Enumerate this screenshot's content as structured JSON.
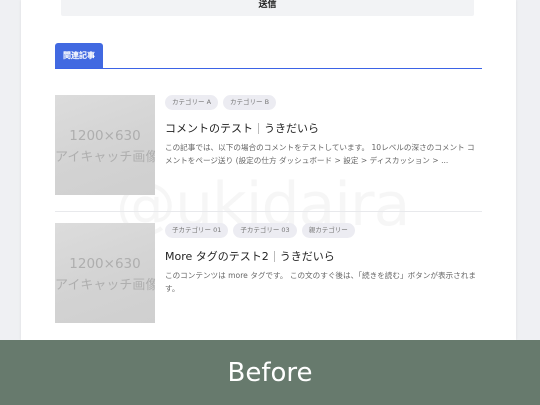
{
  "form": {
    "submit_label": "送信"
  },
  "related": {
    "heading": "関連記事",
    "articles": [
      {
        "thumbnail_line1": "1200×630",
        "thumbnail_line2": "アイキャッチ画像",
        "tags": [
          "カテゴリー A",
          "カテゴリー B"
        ],
        "title": "コメントのテスト",
        "author": "うきだいら",
        "excerpt": "この記事では、以下の場合のコメントをテストしています。 10レベルの深さのコメント コメントをページ送り (設定の仕方 ダッシュボード > 設定 > ディスカッション > ..."
      },
      {
        "thumbnail_line1": "1200×630",
        "thumbnail_line2": "アイキャッチ画像",
        "tags": [
          "子カテゴリー 01",
          "子カテゴリー 03",
          "親カテゴリー"
        ],
        "title": "More タグのテスト2",
        "author": "うきだいら",
        "excerpt": "このコンテンツは more タグです。 この文のすぐ後は、「続きを読む」ボタンが表示されます。"
      }
    ]
  },
  "watermark": "@ukidaira",
  "footer": {
    "label": "Before",
    "band_color": "#677a6d"
  },
  "colors": {
    "accent": "#4169e1"
  }
}
